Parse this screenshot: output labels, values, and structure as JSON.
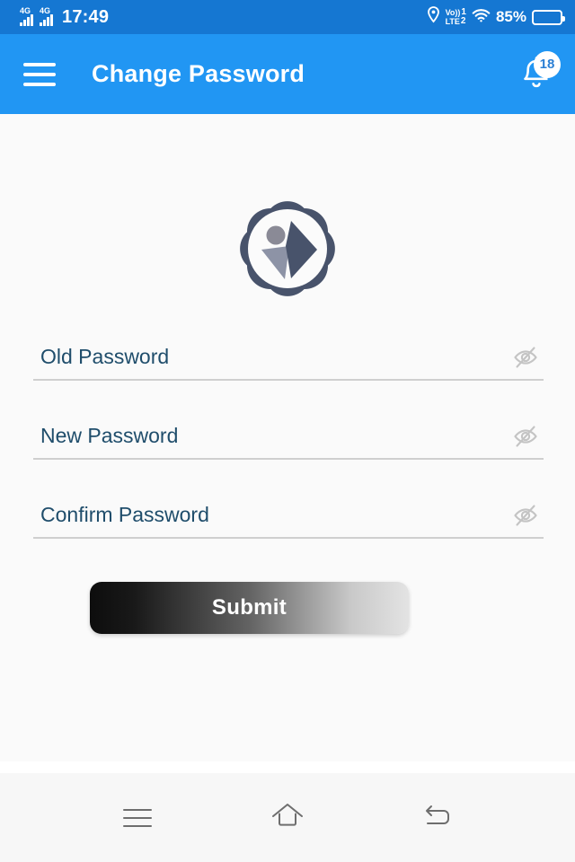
{
  "status_bar": {
    "background_color": "#1577D2",
    "sim1_network": "4G",
    "sim2_network": "4G",
    "time": "17:49",
    "location_icon": "location-pin-icon",
    "volte_label": "Vo))",
    "volte_sim1": "1",
    "lte_label": "LTE",
    "volte_sim2": "2",
    "wifi_icon": "wifi-icon",
    "battery_percent": "85%",
    "battery_level": 85,
    "battery_color": "#F5A623"
  },
  "app_bar": {
    "background_color": "#2196F3",
    "menu_icon": "hamburger-menu-icon",
    "title": "Change Password",
    "notification_icon": "bell-icon",
    "notification_count": "18"
  },
  "logo": {
    "name": "app-logo",
    "petal_color": "#48536B",
    "circle_color": "#FFFFFF",
    "head_color": "#8A8A96",
    "body_color": "#8D93A6",
    "arrow_color": "#48536B"
  },
  "form": {
    "fields": [
      {
        "name": "old-password",
        "placeholder": "Old Password",
        "value": "",
        "toggle_icon": "eye-off-icon"
      },
      {
        "name": "new-password",
        "placeholder": "New Password",
        "value": "",
        "toggle_icon": "eye-off-icon"
      },
      {
        "name": "confirm-password",
        "placeholder": "Confirm Password",
        "value": "",
        "toggle_icon": "eye-off-icon"
      }
    ],
    "submit_label": "Submit",
    "label_color": "#1F4D6B",
    "underline_color": "#CFCFCF"
  },
  "nav_bar": {
    "background_color": "#F7F7F7",
    "recents_icon": "recents-icon",
    "home_icon": "home-icon",
    "back_icon": "back-icon"
  }
}
